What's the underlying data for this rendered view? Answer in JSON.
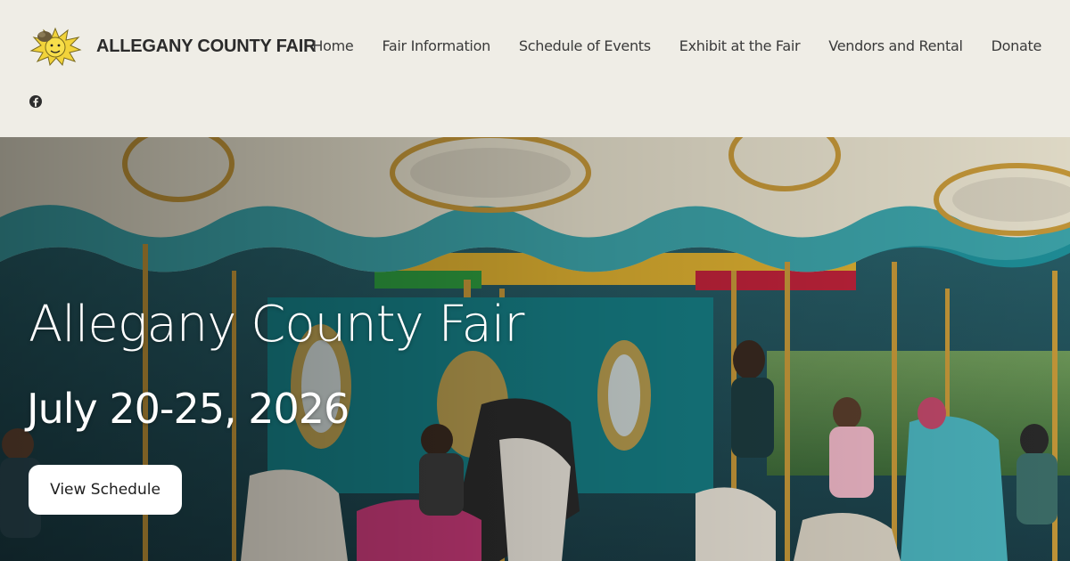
{
  "brand": {
    "name": "ALLEGANY COUNTY FAIR",
    "logo_icon": "sun-mascot-icon"
  },
  "nav": {
    "items": [
      {
        "label": "Home"
      },
      {
        "label": "Fair Information"
      },
      {
        "label": "Schedule of Events"
      },
      {
        "label": "Exhibit at the Fair"
      },
      {
        "label": "Vendors and Rental"
      },
      {
        "label": "Donate"
      }
    ]
  },
  "social": {
    "icon": "facebook-icon"
  },
  "hero": {
    "title": "Allegany County Fair",
    "date": "July 20-25, 2026",
    "cta_label": "View Schedule",
    "image": "carousel-photo"
  },
  "colors": {
    "header_bg": "#efede6",
    "text_dark": "#2b2b2b",
    "cta_bg": "#ffffff",
    "hero_text": "#ffffff"
  }
}
